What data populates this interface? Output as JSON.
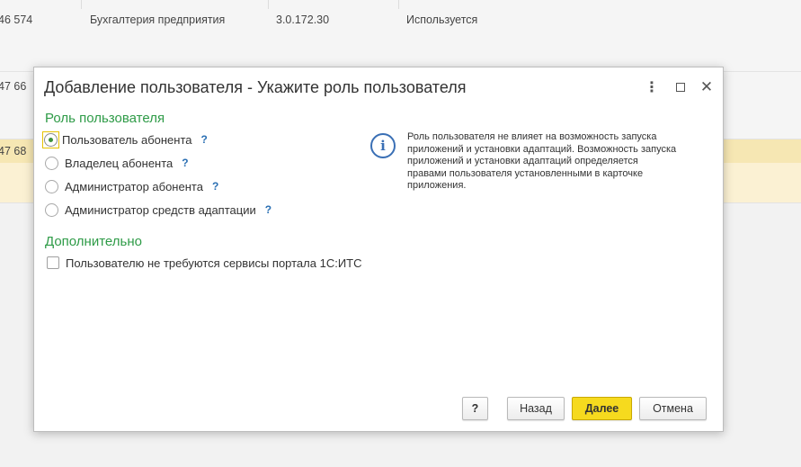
{
  "background": {
    "rows": [
      {
        "id": "46 574",
        "name": "Бухгалтерия предприятия",
        "version": "3.0.172.30",
        "status": "Используется"
      },
      {
        "id": "47 66",
        "name": "",
        "version": "",
        "status": ""
      },
      {
        "id": "47 68",
        "name": "",
        "version": "",
        "status": ""
      }
    ]
  },
  "dialog": {
    "title": "Добавление пользователя - Укажите роль пользователя",
    "more_icon": "⋮",
    "close_icon": "✕",
    "role_section": {
      "title": "Роль пользователя",
      "options": [
        {
          "label": "Пользователь абонента",
          "help": "?",
          "checked": true
        },
        {
          "label": "Владелец абонента",
          "help": "?",
          "checked": false
        },
        {
          "label": "Администратор абонента",
          "help": "?",
          "checked": false
        },
        {
          "label": "Администратор средств адаптации",
          "help": "?",
          "checked": false
        }
      ]
    },
    "info": {
      "icon": "i",
      "text": "Роль пользователя не влияет на возможность запуска приложений и установки адаптаций. Возможность запуска приложений и установки адаптаций определяется правами пользователя установленными в карточке приложения."
    },
    "extra_section": {
      "title": "Дополнительно",
      "checkbox_label": "Пользователю не требуются сервисы портала 1С:ИТС",
      "checked": false
    },
    "buttons": {
      "help": "?",
      "back": "Назад",
      "next": "Далее",
      "cancel": "Отмена"
    }
  },
  "colors": {
    "section_title": "#2e9b47",
    "help_mark": "#2a6fb3",
    "primary_button": "#f6da1e",
    "selected_row": "#fbf1d3"
  }
}
